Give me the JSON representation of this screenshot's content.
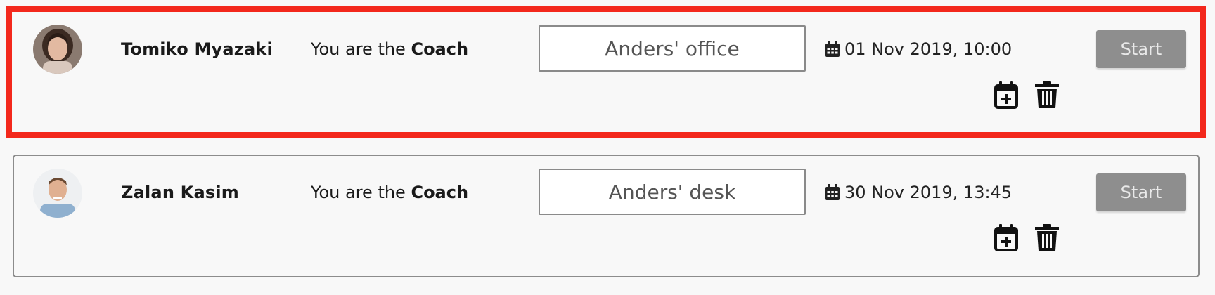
{
  "sessions": [
    {
      "name": "Tomiko Myazaki",
      "role_prefix": "You are the ",
      "role": "Coach",
      "location": "Anders' office",
      "datetime": "01 Nov 2019, 10:00",
      "start_label": "Start",
      "highlighted": true,
      "icons": [
        "calendar-icon",
        "add-to-calendar-icon",
        "delete-trash-icon"
      ]
    },
    {
      "name": "Zalan Kasim",
      "role_prefix": "You are the ",
      "role": "Coach",
      "location": "Anders' desk",
      "datetime": "30 Nov 2019, 13:45",
      "start_label": "Start",
      "highlighted": false,
      "icons": [
        "calendar-icon",
        "add-to-calendar-icon",
        "delete-trash-icon"
      ]
    }
  ],
  "colors": {
    "highlight_border": "#f3281c",
    "start_button_bg": "#8e8e8e",
    "card_bg": "#f8f8f8"
  }
}
